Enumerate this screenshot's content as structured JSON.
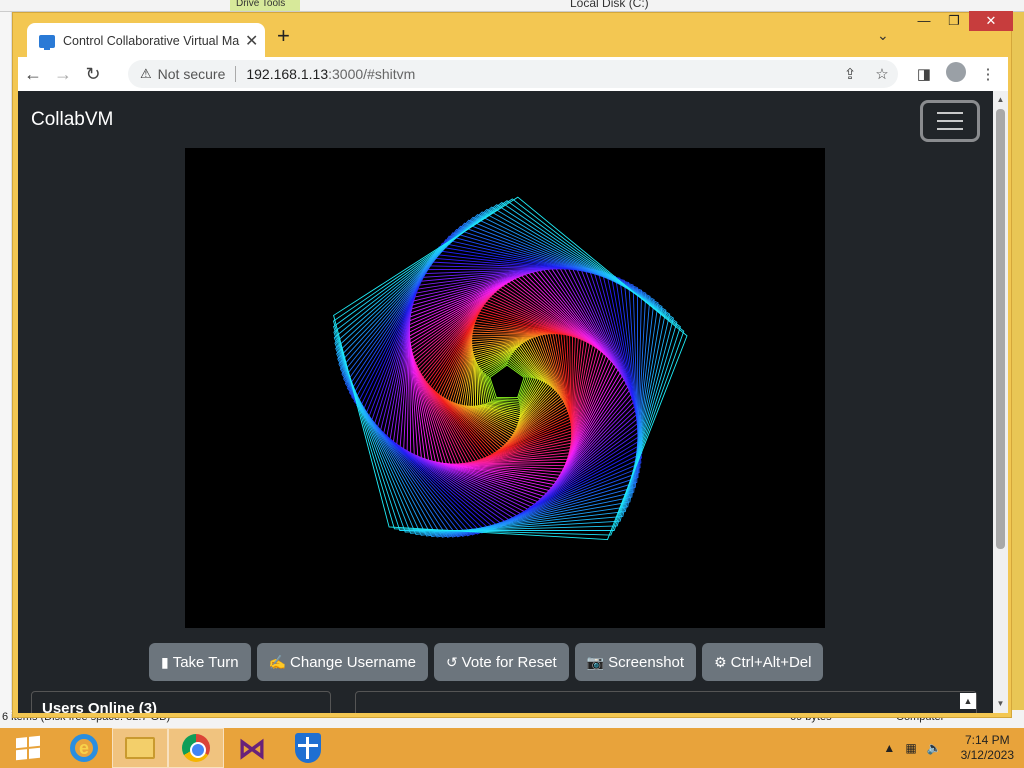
{
  "explorer_bg": {
    "tool_tab": "Drive Tools",
    "title": "Local Disk (C:)",
    "status_left": "6 items (Disk free space: 82.7 GB)",
    "status_mid": "69 bytes",
    "status_right": "Computer"
  },
  "browser": {
    "tab": {
      "title": "Control Collaborative Virtual Ma",
      "close": "✕"
    },
    "new_tab": "+",
    "tab_search": "⌄",
    "window_controls": {
      "minimize": "—",
      "maximize": "❐",
      "close": "✕"
    },
    "nav": {
      "back": "←",
      "forward": "→",
      "reload": "↻"
    },
    "omnibox": {
      "warn_icon": "⚠",
      "security": "Not secure",
      "url_host": "192.168.1.13",
      "url_path": ":3000/#shitvm"
    },
    "omni_icons": {
      "share": "⇪",
      "bookmark": "☆"
    },
    "toolbar_icons": {
      "side_panel": "◨",
      "menu": "⋮"
    }
  },
  "page": {
    "brand": "CollabVM",
    "buttons": [
      {
        "icon": "▮",
        "label": "Take Turn"
      },
      {
        "icon": "✍",
        "label": "Change Username"
      },
      {
        "icon": "↺",
        "label": "Vote for Reset"
      },
      {
        "icon": "📷",
        "label": "Screenshot"
      },
      {
        "icon": "⚙",
        "label": "Ctrl+Alt+Del"
      }
    ],
    "users_online": "Users Online (3)"
  },
  "taskbar": {
    "ie_letter": "e",
    "vs_glyph": "⋈",
    "tray": {
      "arrow": "▲",
      "network": "▦",
      "sound": "🔈"
    },
    "time": "7:14 PM",
    "date": "3/12/2023"
  },
  "colors": {
    "page_bg": "#212529",
    "button_bg": "#6c757d",
    "taskbar": "#e8a33b",
    "window_frame": "#f3c752"
  },
  "icons": [
    "monitor-favicon",
    "warning-icon",
    "share-icon",
    "star-icon",
    "side-panel-icon",
    "profile-icon",
    "kebab-menu-icon",
    "hamburger-icon",
    "mouse-icon",
    "signature-icon",
    "undo-icon",
    "camera-icon",
    "gear-icon",
    "windows-start-icon",
    "internet-explorer-icon",
    "file-explorer-icon",
    "chrome-icon",
    "visual-studio-icon",
    "defender-shield-icon"
  ]
}
